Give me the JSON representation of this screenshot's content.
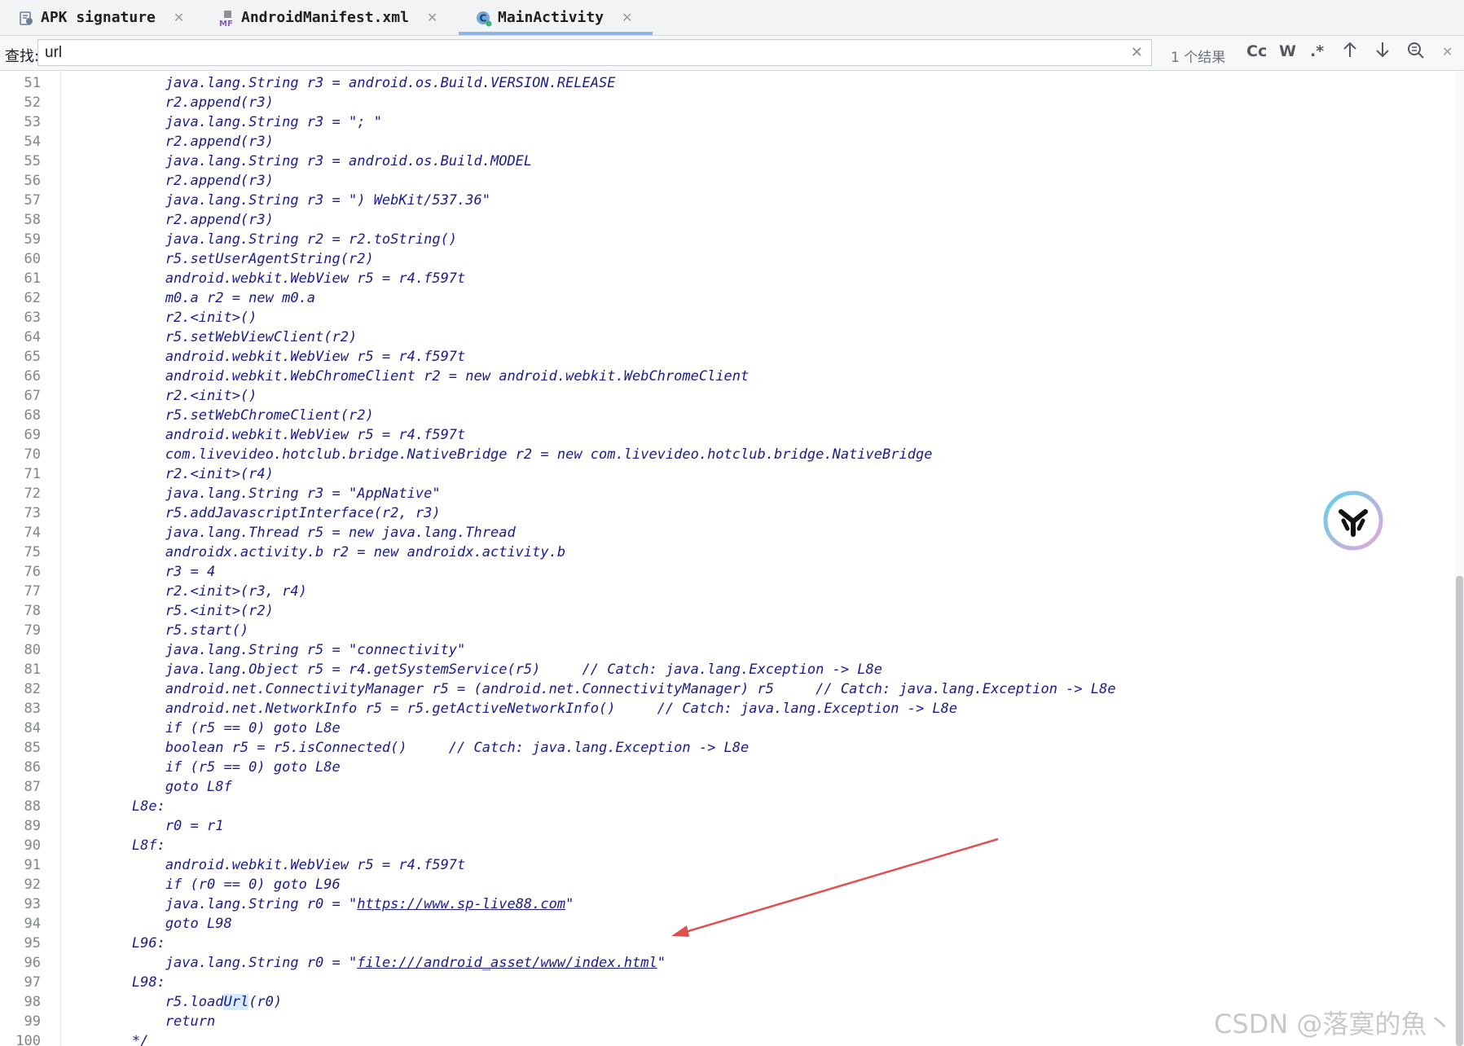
{
  "tabs": [
    {
      "label": "APK signature",
      "icon": "apk-signature-icon",
      "active": false
    },
    {
      "label": "AndroidManifest.xml",
      "icon": "manifest-file-icon",
      "active": false
    },
    {
      "label": "MainActivity",
      "icon": "class-icon",
      "active": true
    }
  ],
  "search": {
    "label": "查找:",
    "value": "url",
    "results": "1 个结果",
    "match_case": "Cc",
    "whole_word": "W",
    "regex": ".*"
  },
  "code_lines": [
    {
      "n": "51",
      "text": "            java.lang.String r3 = android.os.Build.VERSION.RELEASE"
    },
    {
      "n": "52",
      "text": "            r2.append(r3)"
    },
    {
      "n": "53",
      "text": "            java.lang.String r3 = \"; \""
    },
    {
      "n": "54",
      "text": "            r2.append(r3)"
    },
    {
      "n": "55",
      "text": "            java.lang.String r3 = android.os.Build.MODEL"
    },
    {
      "n": "56",
      "text": "            r2.append(r3)"
    },
    {
      "n": "57",
      "text": "            java.lang.String r3 = \") WebKit/537.36\""
    },
    {
      "n": "58",
      "text": "            r2.append(r3)"
    },
    {
      "n": "59",
      "text": "            java.lang.String r2 = r2.toString()"
    },
    {
      "n": "60",
      "text": "            r5.setUserAgentString(r2)"
    },
    {
      "n": "61",
      "text": "            android.webkit.WebView r5 = r4.f597t"
    },
    {
      "n": "62",
      "text": "            m0.a r2 = new m0.a"
    },
    {
      "n": "63",
      "text": "            r2.<init>()"
    },
    {
      "n": "64",
      "text": "            r5.setWebViewClient(r2)"
    },
    {
      "n": "65",
      "text": "            android.webkit.WebView r5 = r4.f597t"
    },
    {
      "n": "66",
      "text": "            android.webkit.WebChromeClient r2 = new android.webkit.WebChromeClient"
    },
    {
      "n": "67",
      "text": "            r2.<init>()"
    },
    {
      "n": "68",
      "text": "            r5.setWebChromeClient(r2)"
    },
    {
      "n": "69",
      "text": "            android.webkit.WebView r5 = r4.f597t"
    },
    {
      "n": "70",
      "text": "            com.livevideo.hotclub.bridge.NativeBridge r2 = new com.livevideo.hotclub.bridge.NativeBridge"
    },
    {
      "n": "71",
      "text": "            r2.<init>(r4)"
    },
    {
      "n": "72",
      "text": "            java.lang.String r3 = \"AppNative\""
    },
    {
      "n": "73",
      "text": "            r5.addJavascriptInterface(r2, r3)"
    },
    {
      "n": "74",
      "text": "            java.lang.Thread r5 = new java.lang.Thread"
    },
    {
      "n": "75",
      "text": "            androidx.activity.b r2 = new androidx.activity.b"
    },
    {
      "n": "76",
      "text": "            r3 = 4"
    },
    {
      "n": "77",
      "text": "            r2.<init>(r3, r4)"
    },
    {
      "n": "78",
      "text": "            r5.<init>(r2)"
    },
    {
      "n": "79",
      "text": "            r5.start()"
    },
    {
      "n": "80",
      "text": "            java.lang.String r5 = \"connectivity\""
    },
    {
      "n": "81",
      "text": "            java.lang.Object r5 = r4.getSystemService(r5)     // Catch: java.lang.Exception -> L8e"
    },
    {
      "n": "82",
      "text": "            android.net.ConnectivityManager r5 = (android.net.ConnectivityManager) r5     // Catch: java.lang.Exception -> L8e"
    },
    {
      "n": "83",
      "text": "            android.net.NetworkInfo r5 = r5.getActiveNetworkInfo()     // Catch: java.lang.Exception -> L8e"
    },
    {
      "n": "84",
      "text": "            if (r5 == 0) goto L8e"
    },
    {
      "n": "85",
      "text": "            boolean r5 = r5.isConnected()     // Catch: java.lang.Exception -> L8e"
    },
    {
      "n": "86",
      "text": "            if (r5 == 0) goto L8e"
    },
    {
      "n": "87",
      "text": "            goto L8f"
    },
    {
      "n": "88",
      "text": "        L8e:"
    },
    {
      "n": "89",
      "text": "            r0 = r1"
    },
    {
      "n": "90",
      "text": "        L8f:"
    },
    {
      "n": "91",
      "text": "            android.webkit.WebView r5 = r4.f597t"
    },
    {
      "n": "92",
      "text": "            if (r0 == 0) goto L96"
    },
    {
      "n": "93",
      "pre": "            java.lang.String r0 = \"",
      "link": "https://www.sp-live88.com",
      "post": "\""
    },
    {
      "n": "94",
      "text": "            goto L98"
    },
    {
      "n": "95",
      "text": "        L96:"
    },
    {
      "n": "96",
      "pre": "            java.lang.String r0 = \"",
      "link": "file:///android_asset/www/index.html",
      "post": "\""
    },
    {
      "n": "97",
      "text": "        L98:"
    },
    {
      "n": "98",
      "pre": "            r5.load",
      "match": "Url",
      "post": "(r0)"
    },
    {
      "n": "99",
      "text": "            return"
    },
    {
      "n": "100",
      "text": "        */"
    }
  ],
  "watermark": "CSDN @落寞的魚丶",
  "colors": {
    "code": "#1a1a8c",
    "arrow": "#e05050",
    "tab_active_underline": "#8fb4e6",
    "match_highlight": "#d7ebff"
  }
}
